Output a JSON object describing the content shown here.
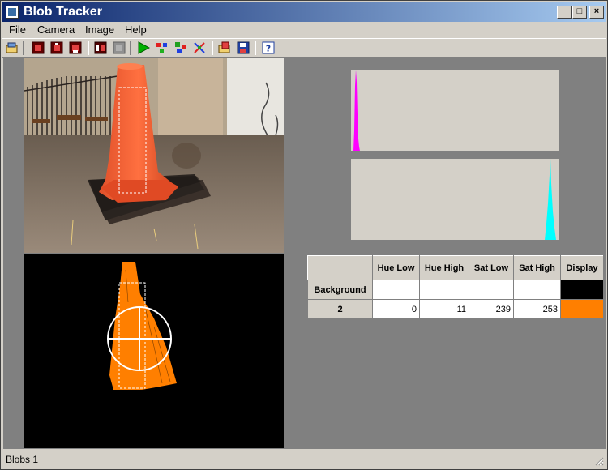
{
  "window": {
    "title": "Blob Tracker"
  },
  "menu": [
    "File",
    "Camera",
    "Image",
    "Help"
  ],
  "toolbar": {
    "icons": [
      "open-icon",
      "record-icon",
      "record-icon",
      "record-icon",
      "capture-icon",
      "stop-icon",
      "play-icon",
      "color-pick-icon",
      "region-icon",
      "swap-icon",
      "load-settings-icon",
      "save-icon",
      "help-icon"
    ]
  },
  "histograms": {
    "hue_color": "#ff00ff",
    "sat_color": "#00ffff"
  },
  "table": {
    "headers": [
      "Hue Low",
      "Hue High",
      "Sat Low",
      "Sat High",
      "Display"
    ],
    "rows": [
      {
        "label": "Background",
        "hue_low": "",
        "hue_high": "",
        "sat_low": "",
        "sat_high": "",
        "display_color": "#000000"
      },
      {
        "label": "2",
        "hue_low": "0",
        "hue_high": "11",
        "sat_low": "239",
        "sat_high": "253",
        "display_color": "#ff7f00"
      }
    ]
  },
  "status": {
    "text": "Blobs 1"
  },
  "colors": {
    "cone": "#ff6a1f",
    "blob": "#ff7f00",
    "titlebar_start": "#0a246a",
    "titlebar_end": "#a6caf0"
  }
}
